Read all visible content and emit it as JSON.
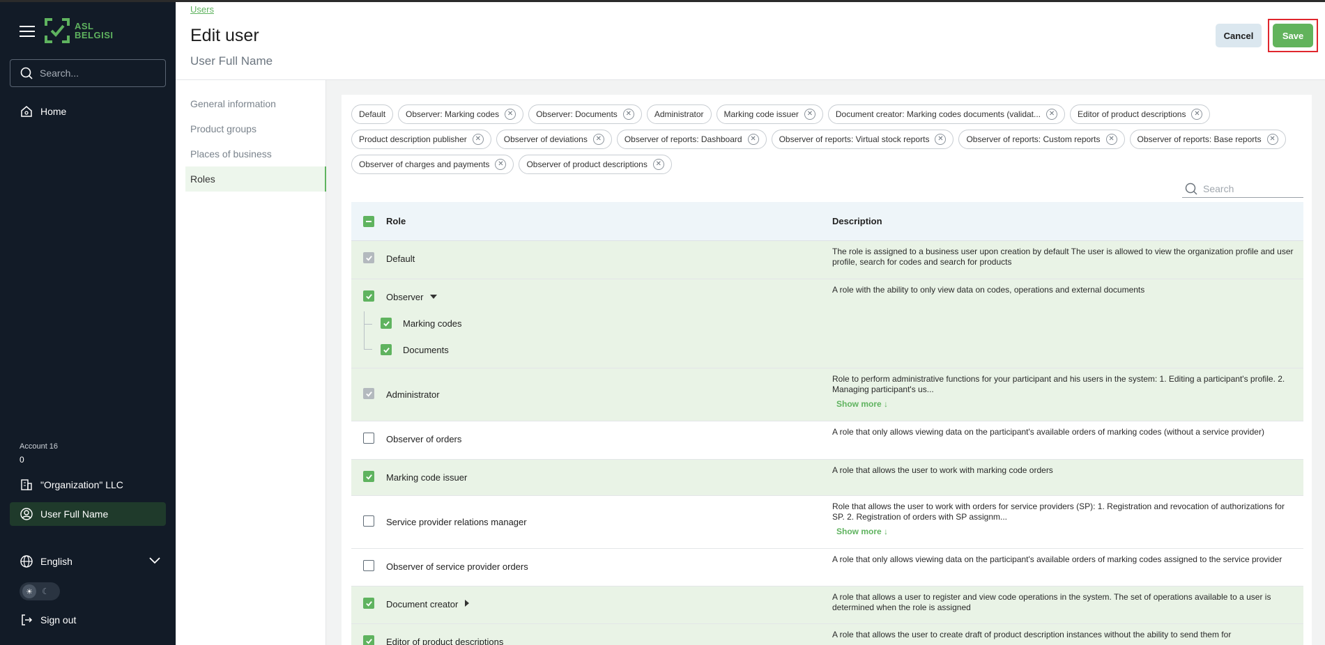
{
  "brand": {
    "logo_line1": "ASL",
    "logo_line2": "BELGISI",
    "accent": "#5fb35f"
  },
  "sidebar": {
    "search_placeholder": "Search...",
    "home": "Home",
    "account_label": "Account 16",
    "account_number": "0",
    "organization": "\"Organization\" LLC",
    "user": "User Full Name",
    "language": "English",
    "sign_out": "Sign out"
  },
  "header": {
    "breadcrumb": "Users",
    "title": "Edit user",
    "subtitle": "User Full Name",
    "cancel": "Cancel",
    "save": "Save"
  },
  "subnav": {
    "items": [
      "General information",
      "Product groups",
      "Places of business",
      "Roles"
    ],
    "active": "Roles"
  },
  "chips": {
    "row1": [
      "Default",
      "Observer: Marking codes",
      "Observer: Documents",
      "Administrator",
      "Marking code issuer",
      "Document creator: Marking codes documents (validat...",
      "Editor of product descriptions"
    ],
    "row2": [
      "Product description publisher",
      "Observer of deviations",
      "Observer of reports: Dashboard",
      "Observer of reports: Virtual stock reports",
      "Observer of reports: Custom reports",
      "Observer of reports: Base reports"
    ],
    "row3": [
      "Observer of charges and payments",
      "Observer of product descriptions"
    ]
  },
  "table": {
    "search_placeholder": "Search",
    "col_role": "Role",
    "col_description": "Description",
    "show_more": "Show more ↓",
    "rows": [
      {
        "role": "Default",
        "desc": "The role is assigned to a business user upon creation by default The user is allowed to view the organization profile and user profile, search for codes and search for products",
        "state": "disabled"
      },
      {
        "role": "Observer",
        "desc": "A role with the ability to only view data on codes, operations and external documents",
        "state": "checked",
        "children": [
          "Marking codes",
          "Documents"
        ]
      },
      {
        "role": "Administrator",
        "desc": "Role to perform administrative functions for your participant and his users in the system: 1. Editing a participant's profile. 2. Managing participant's us...",
        "state": "disabled"
      },
      {
        "role": "Observer of orders",
        "desc": "A role that only allows viewing data on the participant's available orders of marking codes (without a service provider)",
        "state": "unchecked"
      },
      {
        "role": "Marking code issuer",
        "desc": "A role that allows the user to work with marking code orders",
        "state": "checked"
      },
      {
        "role": "Service provider relations manager",
        "desc": "Role that allows the user to work with orders for service providers (SP): 1. Registration and revocation of authorizations for SP. 2. Registration of orders with SP assignm...",
        "state": "unchecked"
      },
      {
        "role": "Observer of service provider orders",
        "desc": "A role that only allows viewing data on the participant's available orders of marking codes assigned to the service provider",
        "state": "unchecked"
      },
      {
        "role": "Document creator",
        "desc": "A role that allows a user to register and view code operations in the system. The set of operations available to a user is determined when the role is assigned",
        "state": "checked"
      },
      {
        "role": "Editor of product descriptions",
        "desc": "A role that allows the user to create draft of product description instances without the ability to send them for",
        "state": "checked"
      }
    ]
  }
}
